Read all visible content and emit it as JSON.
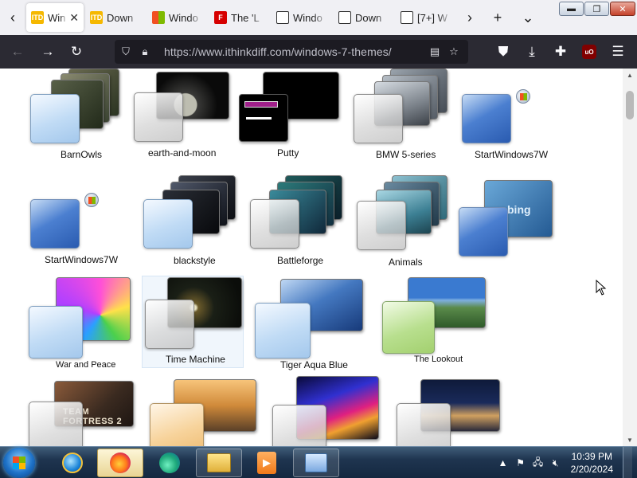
{
  "browser": {
    "tabs": [
      {
        "label": "Win",
        "favicon": "itd-icon",
        "active": true
      },
      {
        "label": "Down",
        "favicon": "itd-icon"
      },
      {
        "label": "Windo",
        "favicon": "windows-icon"
      },
      {
        "label": "The 'L",
        "favicon": "red-f-icon"
      },
      {
        "label": "Windo",
        "favicon": "archive-icon"
      },
      {
        "label": "Down",
        "favicon": "archive-icon"
      },
      {
        "label": "[7+] W",
        "favicon": "archive-icon"
      }
    ],
    "url": "https://www.ithinkdiff.com/windows-7-themes/",
    "ublock_label": "uO"
  },
  "themes": [
    {
      "name": "BarnOwls"
    },
    {
      "name": "earth-and-moon"
    },
    {
      "name": "Putty"
    },
    {
      "name": "BMW 5-series"
    },
    {
      "name": "StartWindows7W"
    },
    {
      "name": "StartWindows7W"
    },
    {
      "name": "blackstyle"
    },
    {
      "name": "Battleforge"
    },
    {
      "name": "Animals"
    },
    {
      "name": "War and Peace"
    },
    {
      "name": "Time Machine"
    },
    {
      "name": "Tiger Aqua Blue"
    },
    {
      "name": "The Lookout"
    }
  ],
  "thumb_text": {
    "bing": "bing",
    "tf2": "TEAM FORTRESS 2"
  },
  "taskbar": {
    "time": "10:39 PM",
    "date": "2/20/2024"
  },
  "colors": {
    "tab_bg": "#f0f0f4",
    "nav_bg": "#2b2a33",
    "url_bg": "#1c1b22",
    "taskbar": "#1f3550"
  }
}
